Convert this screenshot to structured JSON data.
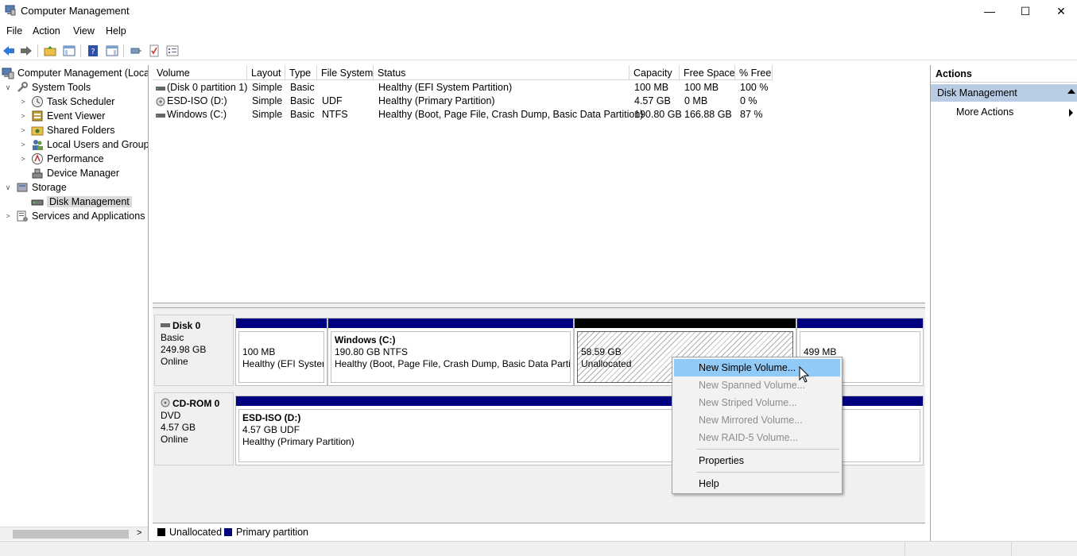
{
  "window": {
    "title": "Computer Management",
    "minimize_glyph": "—",
    "maximize_glyph": "☐",
    "close_glyph": "✕"
  },
  "menu": [
    "File",
    "Action",
    "View",
    "Help"
  ],
  "tree": {
    "root": "Computer Management (Local",
    "items": [
      {
        "label": "System Tools",
        "icon": "tools-icon"
      },
      {
        "label": "Task Scheduler",
        "icon": "clock-icon"
      },
      {
        "label": "Event Viewer",
        "icon": "event-viewer-icon"
      },
      {
        "label": "Shared Folders",
        "icon": "shared-folder-icon"
      },
      {
        "label": "Local Users and Groups",
        "icon": "users-icon"
      },
      {
        "label": "Performance",
        "icon": "performance-icon"
      },
      {
        "label": "Device Manager",
        "icon": "device-manager-icon"
      },
      {
        "label": "Storage",
        "icon": "storage-icon"
      },
      {
        "label": "Disk Management",
        "icon": "disk-icon"
      },
      {
        "label": "Services and Applications",
        "icon": "services-icon"
      }
    ]
  },
  "volumes": {
    "columns": [
      "Volume",
      "Layout",
      "Type",
      "File System",
      "Status",
      "Capacity",
      "Free Space",
      "% Free"
    ],
    "rows": [
      [
        "(Disk 0 partition 1)",
        "Simple",
        "Basic",
        "",
        "Healthy (EFI System Partition)",
        "100 MB",
        "100 MB",
        "100 %"
      ],
      [
        "ESD-ISO (D:)",
        "Simple",
        "Basic",
        "UDF",
        "Healthy (Primary Partition)",
        "4.57 GB",
        "0 MB",
        "0 %"
      ],
      [
        "Windows (C:)",
        "Simple",
        "Basic",
        "NTFS",
        "Healthy (Boot, Page File, Crash Dump, Basic Data Partition)",
        "190.80 GB",
        "166.88 GB",
        "87 %"
      ]
    ]
  },
  "disks": [
    {
      "name": "Disk 0",
      "type": "Basic",
      "size": "249.98 GB",
      "status": "Online",
      "partitions": [
        {
          "name": "",
          "size": "100 MB",
          "status": "Healthy (EFI System"
        },
        {
          "name": "Windows  (C:)",
          "size": "190.80 GB NTFS",
          "status": "Healthy (Boot, Page File, Crash Dump, Basic Data Partiti"
        },
        {
          "name": "",
          "size": "58.59 GB",
          "status": "Unallocated"
        },
        {
          "name": "",
          "size": "499 MB",
          "status": ""
        }
      ]
    },
    {
      "name": "CD-ROM 0",
      "type": "DVD",
      "size": "4.57 GB",
      "status": "Online",
      "partitions": [
        {
          "name": "ESD-ISO  (D:)",
          "size": "4.57 GB UDF",
          "status": "Healthy (Primary Partition)"
        }
      ]
    }
  ],
  "legend": {
    "unallocated": "Unallocated",
    "primary": "Primary partition",
    "unallocated_color": "#000000",
    "primary_color": "#000080"
  },
  "actions": {
    "header": "Actions",
    "section": "Disk Management",
    "more": "More Actions"
  },
  "context_menu": {
    "items": [
      {
        "label": "New Simple Volume...",
        "enabled": true,
        "highlight": true
      },
      {
        "label": "New Spanned Volume...",
        "enabled": false
      },
      {
        "label": "New Striped Volume...",
        "enabled": false
      },
      {
        "label": "New Mirrored Volume...",
        "enabled": false
      },
      {
        "label": "New RAID-5 Volume...",
        "enabled": false
      },
      {
        "label": "Properties",
        "enabled": true
      },
      {
        "label": "Help",
        "enabled": true
      }
    ]
  },
  "colors": {
    "partition_blue": "#000080",
    "unallocated_black": "#000000",
    "selection_blue": "#91c9f7",
    "actions_section": "#b8cde3"
  }
}
